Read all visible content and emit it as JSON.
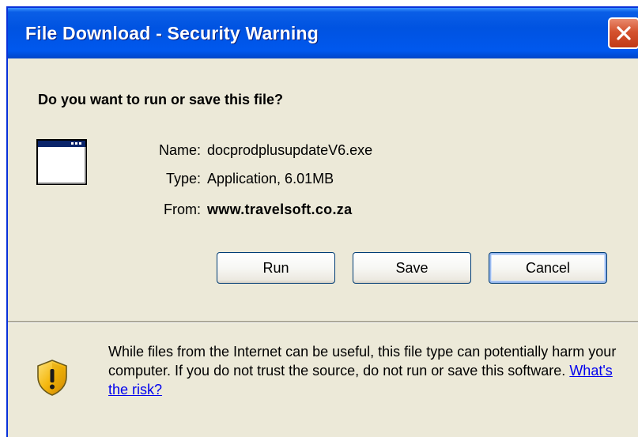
{
  "window": {
    "title": "File Download - Security Warning"
  },
  "dialog": {
    "question": "Do you want to run or save this file?",
    "file": {
      "name_label": "Name:",
      "name_value": "docprodplusupdateV6.exe",
      "type_label": "Type:",
      "type_value": "Application, 6.01MB",
      "from_label": "From:",
      "from_value": "www.travelsoft.co.za"
    },
    "buttons": {
      "run": "Run",
      "save": "Save",
      "cancel": "Cancel"
    },
    "warning": {
      "text": "While files from the Internet can be useful, this file type can potentially harm your computer. If you do not trust the source, do not run or save this software. ",
      "link": "What's the risk?"
    }
  },
  "icons": {
    "file": "application-window-icon",
    "warning": "security-shield-icon",
    "close": "close-icon"
  },
  "colors": {
    "titlebar": "#0053e1",
    "close_button": "#d4522e",
    "dialog_background": "#ece9d8",
    "link": "#0000ee",
    "shield": "#f5b80f"
  }
}
